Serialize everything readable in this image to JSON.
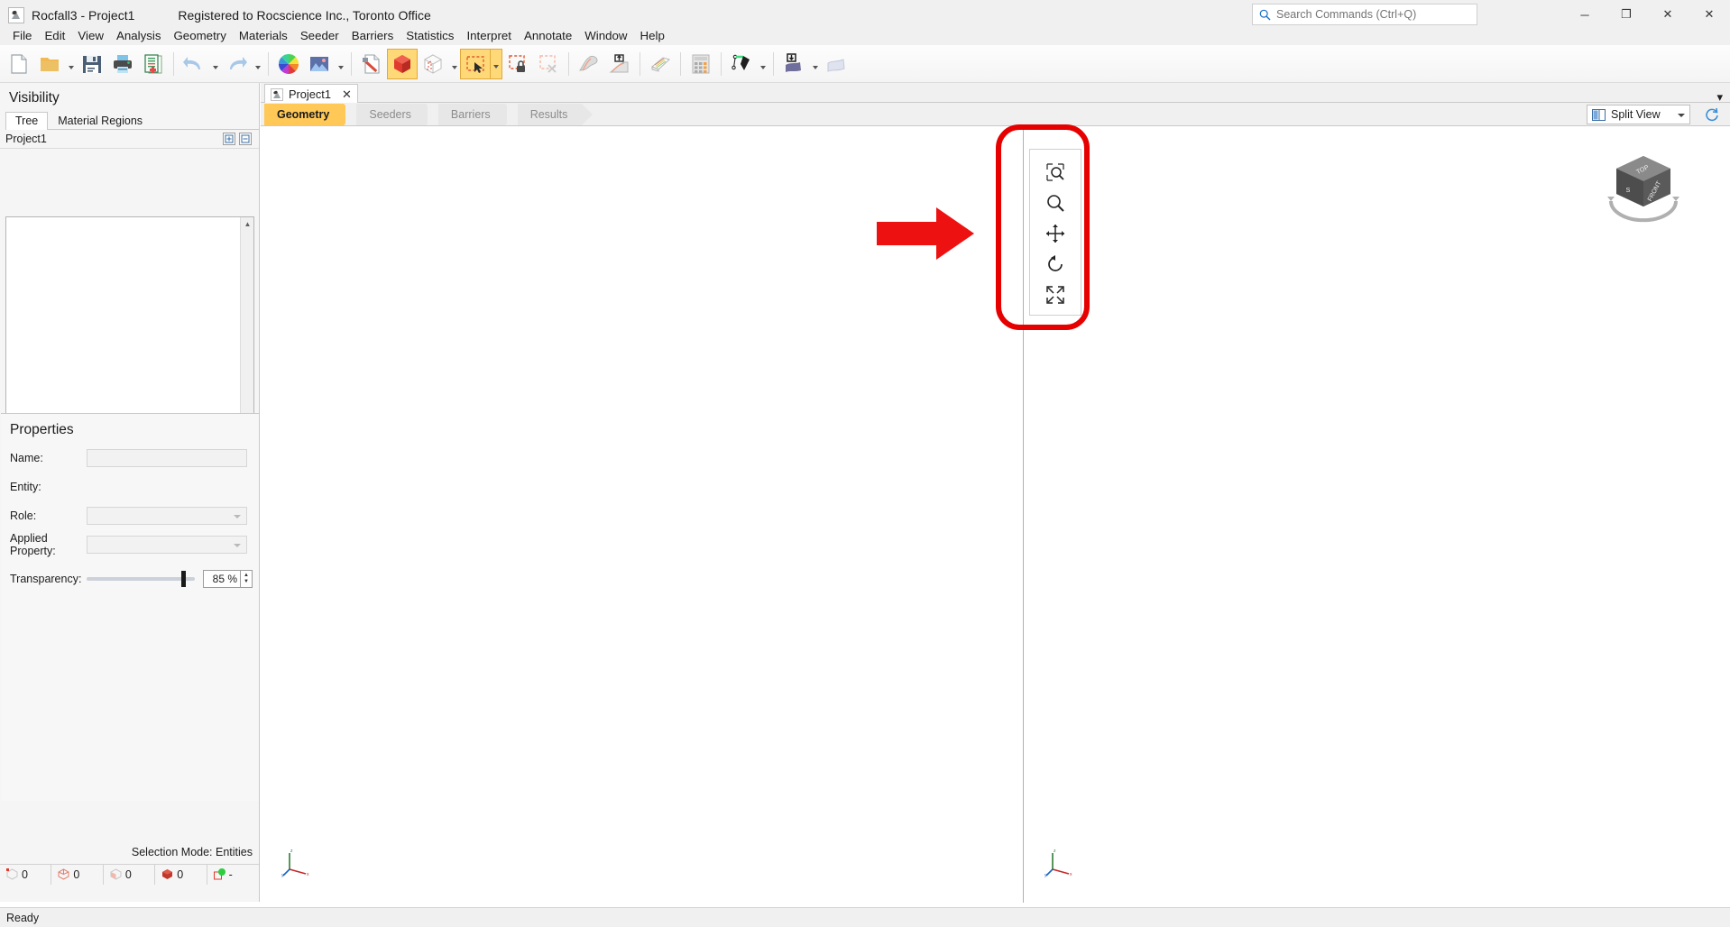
{
  "titlebar": {
    "app_icon": "rocfall-icon",
    "title": "Rocfall3 - Project1",
    "license": "Registered to Rocscience Inc., Toronto Office",
    "search_placeholder": "Search Commands (Ctrl+Q)",
    "search_value": "",
    "minimize": "─",
    "maximize": "❐",
    "close": "✕",
    "close_outer": "✕"
  },
  "menubar": {
    "items": [
      {
        "label": "File"
      },
      {
        "label": "Edit"
      },
      {
        "label": "View"
      },
      {
        "label": "Analysis"
      },
      {
        "label": "Geometry"
      },
      {
        "label": "Materials"
      },
      {
        "label": "Seeder"
      },
      {
        "label": "Barriers"
      },
      {
        "label": "Statistics"
      },
      {
        "label": "Interpret"
      },
      {
        "label": "Annotate"
      },
      {
        "label": "Window"
      },
      {
        "label": "Help"
      }
    ]
  },
  "toolbar": {
    "buttons": [
      {
        "name": "new-file-icon",
        "kind": "icon",
        "selected": false
      },
      {
        "name": "open-folder-icon",
        "kind": "icon",
        "selected": false
      },
      {
        "name": "open-folder-dropdown",
        "kind": "caret",
        "selected": false
      },
      {
        "name": "save-icon",
        "kind": "icon",
        "selected": false
      },
      {
        "name": "print-icon",
        "kind": "icon",
        "selected": false
      },
      {
        "name": "report-icon",
        "kind": "icon",
        "selected": false
      },
      {
        "name": "separator",
        "kind": "sep"
      },
      {
        "name": "undo-icon",
        "kind": "icon",
        "selected": false
      },
      {
        "name": "undo-dropdown",
        "kind": "caret",
        "selected": false
      },
      {
        "name": "redo-icon",
        "kind": "icon",
        "selected": false
      },
      {
        "name": "redo-dropdown",
        "kind": "caret",
        "selected": false
      },
      {
        "name": "separator",
        "kind": "sep"
      },
      {
        "name": "color-wheel-icon",
        "kind": "icon",
        "selected": false
      },
      {
        "name": "image-export-icon",
        "kind": "icon",
        "selected": false
      },
      {
        "name": "image-export-dropdown",
        "kind": "caret",
        "selected": false
      },
      {
        "name": "separator",
        "kind": "sep"
      },
      {
        "name": "edit-properties-icon",
        "kind": "icon",
        "selected": false
      },
      {
        "name": "solid-geometry-icon",
        "kind": "icon",
        "selected": true
      },
      {
        "name": "mesh-geometry-icon",
        "kind": "icon",
        "selected": false
      },
      {
        "name": "mesh-geometry-dropdown",
        "kind": "caret",
        "selected": false
      },
      {
        "name": "select-entities-icon",
        "kind": "icon",
        "selected": true
      },
      {
        "name": "select-entities-dropdown",
        "kind": "caret",
        "selected": true
      },
      {
        "name": "lock-selection-icon",
        "kind": "icon",
        "selected": false
      },
      {
        "name": "clear-selection-icon",
        "kind": "icon",
        "selected": false
      },
      {
        "name": "separator",
        "kind": "sep"
      },
      {
        "name": "slope-surface-icon",
        "kind": "icon",
        "selected": false
      },
      {
        "name": "import-slope-icon",
        "kind": "icon",
        "selected": false
      },
      {
        "name": "separator",
        "kind": "sep"
      },
      {
        "name": "layers-icon",
        "kind": "icon",
        "selected": false
      },
      {
        "name": "separator",
        "kind": "sep"
      },
      {
        "name": "calculator-icon",
        "kind": "icon",
        "selected": false
      },
      {
        "name": "separator",
        "kind": "sep"
      },
      {
        "name": "seeder-icon",
        "kind": "icon",
        "selected": false
      },
      {
        "name": "seeder-dropdown",
        "kind": "caret",
        "selected": false
      },
      {
        "name": "separator",
        "kind": "sep"
      },
      {
        "name": "barrier-import-icon",
        "kind": "icon",
        "selected": false
      },
      {
        "name": "barrier-import-dropdown",
        "kind": "caret",
        "selected": false
      },
      {
        "name": "barrier-icon",
        "kind": "icon",
        "selected": false
      }
    ]
  },
  "left_panel": {
    "visibility_title": "Visibility",
    "tabs": [
      {
        "label": "Tree",
        "active": true
      },
      {
        "label": "Material Regions",
        "active": false
      }
    ],
    "tree_root_label": "Project1",
    "tree_expand_all_icon": "expand-all-icon",
    "tree_collapse_all_icon": "collapse-all-icon",
    "tree_items": [],
    "properties": {
      "title": "Properties",
      "fields": [
        {
          "label": "Name:",
          "type": "text",
          "value": ""
        },
        {
          "label": "Entity:",
          "type": "static",
          "value": ""
        },
        {
          "label": "Role:",
          "type": "combo",
          "value": ""
        },
        {
          "label": "Applied Property:",
          "type": "combo",
          "value": ""
        }
      ],
      "transparency_label": "Transparency:",
      "transparency_value": "85 %",
      "transparency_percent": 85
    },
    "selection_mode": "Selection Mode: Entities",
    "counts": [
      {
        "icon": "vertex-count-icon",
        "value": "0"
      },
      {
        "icon": "edge-count-icon",
        "value": "0"
      },
      {
        "icon": "face-count-icon",
        "value": "0"
      },
      {
        "icon": "solid-count-icon",
        "value": "0"
      },
      {
        "icon": "material-count-icon",
        "value": "-"
      }
    ]
  },
  "document_tabs": {
    "tabs": [
      {
        "icon": "rocfall-doc-icon",
        "label": "Project1",
        "close": "✕",
        "active": true
      }
    ],
    "overflow_caret": "▾"
  },
  "stage_bar": {
    "stages": [
      {
        "label": "Geometry",
        "active": true
      },
      {
        "label": "Seeders",
        "active": false
      },
      {
        "label": "Barriers",
        "active": false
      },
      {
        "label": "Results",
        "active": false
      }
    ],
    "split_view_icon": "split-view-icon",
    "split_view_label": "Split View",
    "refresh_icon": "refresh-icon"
  },
  "viewports": {
    "left": {
      "name": "viewport-left",
      "axis_gizmo": "axis-gizmo-xyz"
    },
    "right": {
      "name": "viewport-right",
      "axis_gizmo": "axis-gizmo-xyz"
    },
    "view_cube": {
      "name": "view-cube",
      "top_label": "TOP",
      "front_label": "FRONT",
      "side_label": "S"
    }
  },
  "nav_toolbar": {
    "buttons": [
      {
        "name": "zoom-window-icon"
      },
      {
        "name": "zoom-icon"
      },
      {
        "name": "pan-icon"
      },
      {
        "name": "rotate-icon"
      },
      {
        "name": "zoom-all-icon"
      }
    ]
  },
  "annotation": {
    "highlight_color": "#e60000",
    "shape": "rounded-rect-highlight",
    "arrow": "red-arrow-pointer"
  },
  "statusbar": {
    "message": "Ready"
  }
}
